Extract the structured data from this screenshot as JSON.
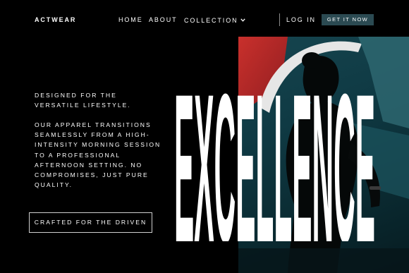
{
  "header": {
    "logo": "ACTWEAR",
    "nav": {
      "home": "HOME",
      "about": "ABOUT",
      "collection": "COLLECTION"
    },
    "login": "LOG IN",
    "cta": "GET IT NOW"
  },
  "hero": {
    "tagline": "DESIGNED FOR THE\nVERSATILE LIFESTYLE.",
    "body": "OUR APPAREL TRANSITIONS\nSEAMLESSLY FROM A HIGH-\nINTENSITY MORNING SESSION\nTO A PROFESSIONAL\nAFTERNOON SETTING. NO\nCOMPROMISES, JUST PURE\nQUALITY.",
    "cta": "CRAFTED FOR THE DRIVEN",
    "headline": "EXCELLENCE"
  },
  "colors": {
    "background": "#000000",
    "text": "#ffffff",
    "cta_fill": "#2b4a52",
    "photo_teal": "#16454f",
    "photo_red": "#b5262a"
  },
  "icons": {
    "collection_dropdown": "chevron-down-icon"
  }
}
